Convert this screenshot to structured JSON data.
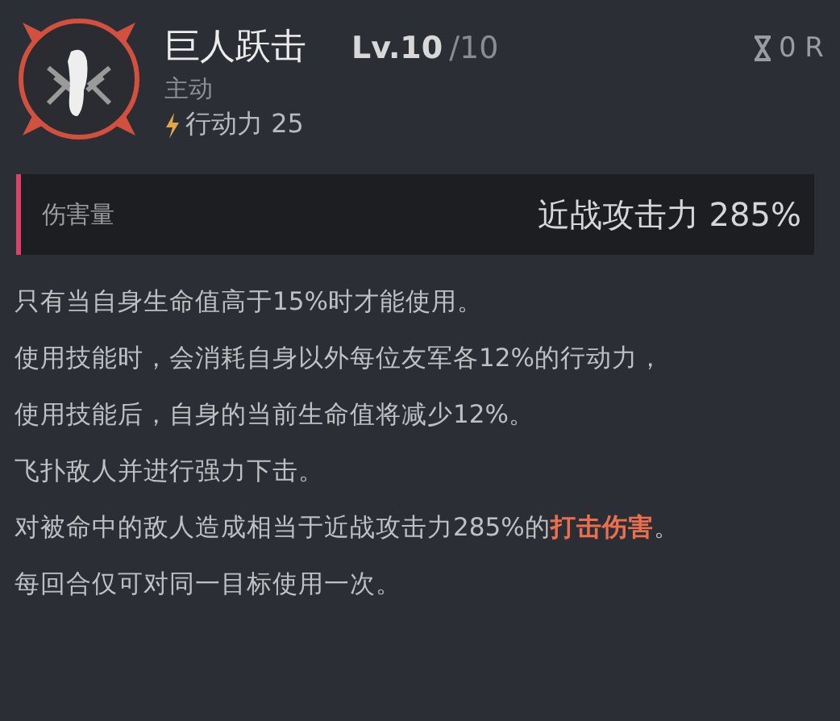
{
  "skill": {
    "name": "巨人跃击",
    "level": "Lv.10",
    "max_level": "/10",
    "cooldown": "0 R",
    "type": "主动",
    "cost": "行动力 25"
  },
  "damage": {
    "label": "伤害量",
    "value": "近战攻击力 285%"
  },
  "description": [
    [
      {
        "kind": "normal",
        "text": "只有当自身生命值高于15%时才能使用。"
      }
    ],
    [
      {
        "kind": "normal",
        "text": "使用技能时，会消耗自身以外每位友军各12%的行动力，"
      }
    ],
    [
      {
        "kind": "normal",
        "text": "使用技能后，自身的当前生命值将减少12%。"
      }
    ],
    [
      {
        "kind": "normal",
        "text": "飞扑敌人并进行强力下击。"
      }
    ],
    [
      {
        "kind": "normal",
        "text": "对被命中的敌人造成相当于近战攻击力285%的"
      },
      {
        "kind": "highlight",
        "text": "打击伤害"
      },
      {
        "kind": "normal",
        "text": "。"
      }
    ],
    [
      {
        "kind": "normal",
        "text": "每回合仅可对同一目标使用一次。"
      }
    ]
  ]
}
